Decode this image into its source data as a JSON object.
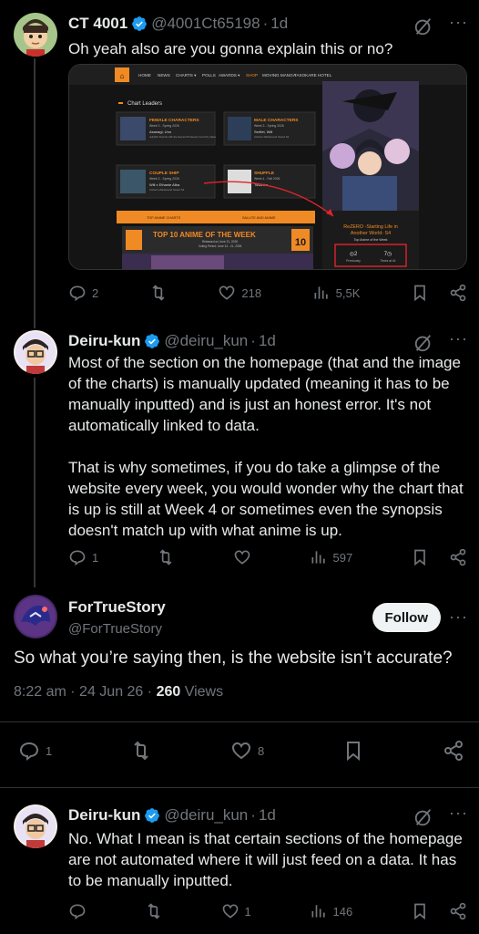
{
  "tweets": [
    {
      "name": "CT 4001",
      "handle": "@4001Ct65198",
      "time": "1d",
      "text": "Oh yeah also are you gonna explain this or no?",
      "replies": "2",
      "likes": "218",
      "views": "5,5K",
      "media": {
        "nav": [
          "HOME",
          "NEWS",
          "CHARTS ▾",
          "POLLS",
          "AWARDS ▾",
          "SHOP",
          "MOVING MANGA",
          "TASOKARE HOTEL"
        ],
        "chart_leaders": "Chart Leaders",
        "cards": [
          {
            "title": "FEMALE CHARACTERS",
            "sub": "Week 3 - Spring 2026",
            "name": "Asanagi, Uno",
            "desc": "Jellyfish Friends with the Second Professor Can't Fly Class"
          },
          {
            "title": "MALE CHARACTERS",
            "sub": "Week 3 - Spring 2026",
            "name": "Serflet, Will",
            "desc": "Ambezo Wanarsend Sword S2"
          },
          {
            "title": "COUPLE SHIP",
            "sub": "Week 3 - Spring 2026",
            "name": "Will x Ethanie Alba",
            "desc": "Ambezo Wanarsend Sword S2"
          },
          {
            "title": "SHUFFLE",
            "sub": "Week 4 - Fall 2026",
            "name": "Tosahha",
            "desc": ""
          }
        ],
        "bar_left": "TOP ANIME CHARTS",
        "bar_right": "SALUTE AND ANIME",
        "top10_title": "TOP 10 ANIME OF THE WEEK",
        "top10_sub1": "Released on June 21, 2026",
        "top10_sub2": "Voting Period: June 14 - 21, 2026",
        "top10_num": "10",
        "poster_title": "ReZERO -Starting Life in Another World- S4",
        "poster_sub": "Top Anime of the Week",
        "prev_num": "2",
        "times_num": "7",
        "prev_label": "Previously",
        "times_label": "Times at #1"
      }
    },
    {
      "name": "Deiru-kun",
      "handle": "@deiru_kun",
      "time": "1d",
      "text1": "Most of the section on the homepage (that and the image of the charts) is manually updated (meaning it has to be manually inputted) and is just an honest error. It's not automatically linked to data.",
      "text2": "That is why sometimes, if you do take a glimpse of the website every week, you would wonder why the chart that is up is still at Week 4 or sometimes even the synopsis doesn't match up with what anime is up.",
      "replies": "1",
      "views": "597"
    },
    {
      "name": "ForTrueStory",
      "handle": "@ForTrueStory",
      "follow": "Follow",
      "text": "So what you’re saying then, is the website isn’t accurate?",
      "time": "8:22 am",
      "date": "24 Jun 26",
      "views_num": "260",
      "views_label": "Views",
      "replies": "1",
      "likes": "8"
    },
    {
      "name": "Deiru-kun",
      "handle": "@deiru_kun",
      "time": "1d",
      "text": "No. What I mean is that certain sections of the homepage are not automated where it will just feed on a data. It has to be manually inputted.",
      "likes": "1",
      "views": "146"
    }
  ],
  "colors": {
    "verified": "#1d9bf0",
    "muted": "#71767b",
    "accent_orange": "#f08a24"
  }
}
